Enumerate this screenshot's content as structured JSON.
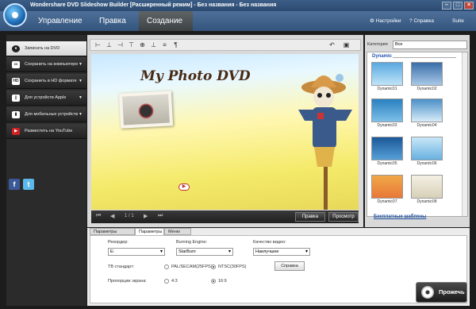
{
  "window": {
    "title": "Wondershare DVD Slideshow Builder [Расширенный режим] - Без названия - Без названия"
  },
  "topnav": {
    "tabs": [
      {
        "label": "Управление"
      },
      {
        "label": "Правка"
      },
      {
        "label": "Создание"
      }
    ],
    "settings": "Настройки",
    "help": "Справка",
    "suite": "Suite"
  },
  "sidebar": {
    "items": [
      {
        "label": "Записать на DVD",
        "icon": "disc-icon"
      },
      {
        "label": "Сохранить на компьютере",
        "icon": "monitor-icon"
      },
      {
        "label": "Сохранить в HD формате",
        "icon": "hd-icon"
      },
      {
        "label": "Для устройств Apple",
        "icon": "ipod-icon"
      },
      {
        "label": "Для мобильных устройств",
        "icon": "phone-icon"
      },
      {
        "label": "Разместить на YouTube",
        "icon": "youtube-icon"
      }
    ]
  },
  "preview": {
    "stage_title": "My Photo DVD",
    "page_indicator": "1 / 1",
    "edit_button": "Правка",
    "preview_button": "Просмотр"
  },
  "templates": {
    "category_label": "Категория",
    "category_value": "Все",
    "group": "Dynamic",
    "items": [
      "Dynamic01",
      "Dynamic02",
      "Dynamic03",
      "Dynamic04",
      "Dynamic05",
      "Dynamic06",
      "Dynamic07",
      "Dynamic08"
    ],
    "free_link": "Бесплатные шаблоны"
  },
  "settings": {
    "tabs": [
      "Параметры вывода",
      "Параметры",
      "Меню DVD"
    ],
    "recorder_label": "Рекордер:",
    "recorder_value": "E:",
    "engine_label": "Burning Engine:",
    "engine_value": "StarBurn",
    "quality_label": "Качество видео:",
    "quality_value": "Наилучшее",
    "tv_label": "ТВ стандарт:",
    "tv_pal": "PAL/SECAM(25FPS)",
    "tv_ntsc": "NTSC(30FPS)",
    "aspect_label": "Пропорции экрана:",
    "aspect_43": "4:3",
    "aspect_169": "16:9",
    "help_button": "Справка"
  },
  "burn": {
    "label": "Прожечь"
  }
}
